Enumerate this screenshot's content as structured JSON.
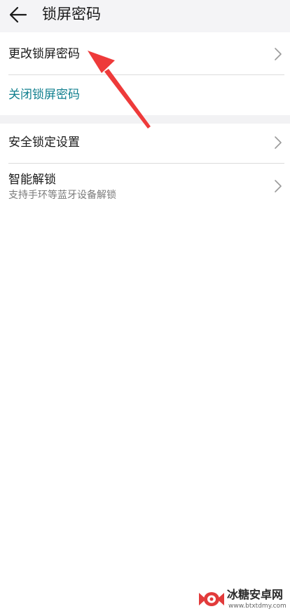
{
  "header": {
    "back_icon": "arrow-left-icon",
    "title": "锁屏密码"
  },
  "items": {
    "change_password": {
      "label": "更改锁屏密码",
      "icon": "chevron-right-icon"
    },
    "close_password": {
      "label": "关闭锁屏密码",
      "color": "#12808f"
    },
    "security_lock_settings": {
      "label": "安全锁定设置",
      "icon": "chevron-right-icon"
    },
    "smart_unlock": {
      "label": "智能解锁",
      "subtitle": "支持手环等蓝牙设备解锁",
      "icon": "chevron-right-icon"
    }
  },
  "annotation": {
    "color": "#ee3a3a",
    "icon": "red-arrow-annotation"
  },
  "watermark": {
    "name": "冰糖安卓网",
    "url": "www.btxtdmy.com"
  }
}
